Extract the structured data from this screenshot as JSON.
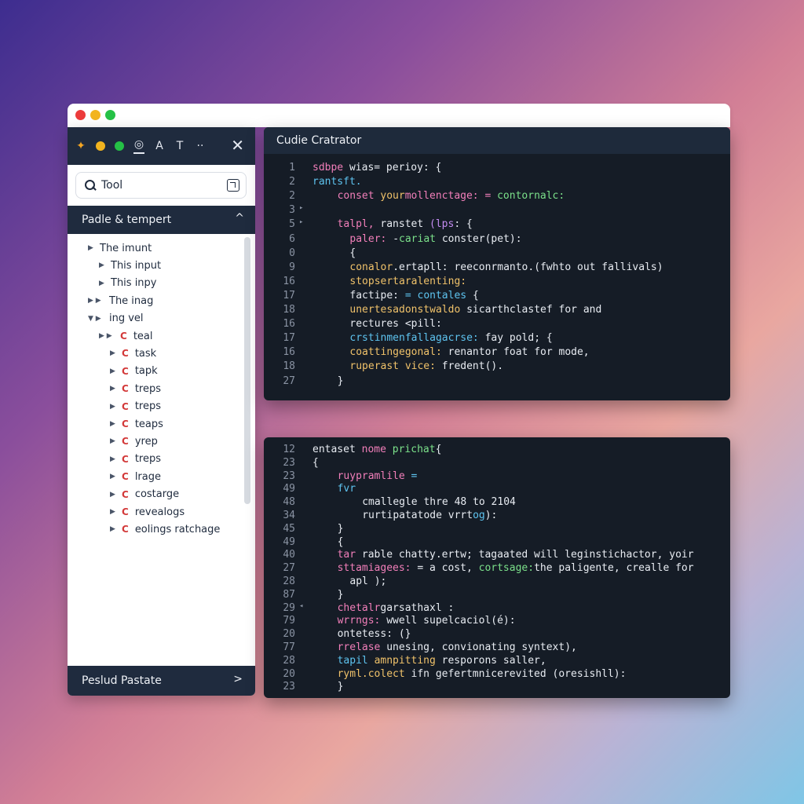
{
  "toolbar": {
    "tools": [
      "spark-tool",
      "yellow-tool",
      "green-tool",
      "globe-tool",
      "lock-tool",
      "text-tool",
      "more-tool"
    ],
    "tool_glyphs": [
      "✦",
      "",
      "",
      "◎",
      "A",
      "T",
      "··"
    ],
    "close_glyph": "✕"
  },
  "search": {
    "value": "Tool"
  },
  "section": {
    "title": "Padle & tempert",
    "chevron": "^"
  },
  "tree": [
    {
      "label": "The imunt",
      "level": 0,
      "arrow": "▶",
      "icon": ""
    },
    {
      "label": "This input",
      "level": 1,
      "arrow": "▶",
      "icon": ""
    },
    {
      "label": "This inpy",
      "level": 1,
      "arrow": "▶",
      "icon": ""
    },
    {
      "label": "The inag",
      "level": 0,
      "arrow": "▶ ▶",
      "icon": ""
    },
    {
      "label": "ing vel",
      "level": 0,
      "arrow": "▼ ▶",
      "icon": ""
    },
    {
      "label": "teal",
      "level": 1,
      "arrow": "▶ ▶",
      "icon": "C"
    },
    {
      "label": "task",
      "level": 2,
      "arrow": "▶",
      "icon": "C"
    },
    {
      "label": "tapk",
      "level": 2,
      "arrow": "▶",
      "icon": "C"
    },
    {
      "label": "treps",
      "level": 2,
      "arrow": "▶",
      "icon": "C"
    },
    {
      "label": "treps",
      "level": 2,
      "arrow": "▶",
      "icon": "C"
    },
    {
      "label": "teaps",
      "level": 2,
      "arrow": "▶",
      "icon": "C"
    },
    {
      "label": "yrep",
      "level": 2,
      "arrow": "▶",
      "icon": "C"
    },
    {
      "label": "treps",
      "level": 2,
      "arrow": "▶",
      "icon": "C"
    },
    {
      "label": "lrage",
      "level": 2,
      "arrow": "▶",
      "icon": "C"
    },
    {
      "label": "costarge",
      "level": 2,
      "arrow": "▶",
      "icon": "C"
    },
    {
      "label": "revealogs",
      "level": 2,
      "arrow": "▶",
      "icon": "C"
    },
    {
      "label": "eolings ratchage",
      "level": 2,
      "arrow": "▶",
      "icon": "C"
    }
  ],
  "footer": {
    "label": "Peslud Pastate",
    "chevron": ">"
  },
  "editor_top": {
    "title": "Cudie Cratrator",
    "lines": [
      {
        "n": "1",
        "indent": 0,
        "parts": [
          [
            "pink",
            "sdbpe "
          ],
          [
            "white",
            "wias= perioy: {"
          ]
        ]
      },
      {
        "n": "2",
        "indent": 0,
        "parts": [
          [
            "blue",
            "rantsft."
          ]
        ]
      },
      {
        "n": "2",
        "indent": 2,
        "parts": [
          [
            "pink",
            "conset "
          ],
          [
            "yellow",
            "your"
          ],
          [
            "pink",
            "mollenctage: = "
          ],
          [
            "green",
            "contornalc:"
          ]
        ]
      },
      {
        "n": "3",
        "indent": 0,
        "fold": "▸",
        "parts": []
      },
      {
        "n": "5",
        "indent": 2,
        "fold": "▸",
        "parts": [
          [
            "pink",
            "talpl, "
          ],
          [
            "white",
            "ranstet "
          ],
          [
            "purple",
            "(lps"
          ],
          [
            "white",
            ": {"
          ]
        ]
      },
      {
        "n": "6",
        "indent": 3,
        "parts": [
          [
            "pink",
            "paler: "
          ],
          [
            "white",
            "-"
          ],
          [
            "green",
            "cariat "
          ],
          [
            "white",
            "conster(pet):"
          ]
        ]
      },
      {
        "n": "0",
        "indent": 3,
        "parts": [
          [
            "white",
            "{"
          ]
        ]
      },
      {
        "n": "9",
        "indent": 3,
        "parts": [
          [
            "yellow",
            "conalor"
          ],
          [
            "white",
            ".ertapll: reeconrmanto.(fwhto out fallivals)"
          ]
        ]
      },
      {
        "n": "16",
        "indent": 3,
        "parts": [
          [
            "yellow",
            "stopsertaralenting:"
          ]
        ]
      },
      {
        "n": "17",
        "indent": 3,
        "parts": [
          [
            "white",
            "factipe: "
          ],
          [
            "blue",
            "= contales "
          ],
          [
            "white",
            "{"
          ]
        ]
      },
      {
        "n": "18",
        "indent": 3,
        "parts": [
          [
            "yellow",
            "unertesadonstwaldo "
          ],
          [
            "white",
            "sicarthclastef for and"
          ]
        ]
      },
      {
        "n": "16",
        "indent": 3,
        "parts": [
          [
            "white",
            " rectures <pill:"
          ]
        ]
      },
      {
        "n": "17",
        "indent": 3,
        "parts": [
          [
            "blue",
            " crstinmenfallagacrse: "
          ],
          [
            "white",
            "fay pold; {"
          ]
        ]
      },
      {
        "n": "16",
        "indent": 3,
        "parts": [
          [
            "yellow",
            " coattingegonal: "
          ],
          [
            "white",
            "renantor foat for mode,"
          ]
        ]
      },
      {
        "n": "18",
        "indent": 3,
        "parts": [
          [
            "yellow",
            "ruperast vice: "
          ],
          [
            "white",
            "fredent()."
          ]
        ]
      },
      {
        "n": "27",
        "indent": 2,
        "parts": [
          [
            "white",
            "}"
          ]
        ]
      }
    ]
  },
  "editor_bottom": {
    "lines": [
      {
        "n": "12",
        "indent": 0,
        "parts": [
          [
            "white",
            "entaset "
          ],
          [
            "pink",
            "nome "
          ],
          [
            "green",
            "prichat"
          ],
          [
            "white",
            "{"
          ]
        ]
      },
      {
        "n": "23",
        "indent": 0,
        "parts": [
          [
            "white",
            "{"
          ]
        ]
      },
      {
        "n": "23",
        "indent": 2,
        "parts": [
          [
            "pink",
            "ruypramlile "
          ],
          [
            "blue",
            "="
          ]
        ]
      },
      {
        "n": "49",
        "indent": 2,
        "parts": [
          [
            "blue",
            "fvr"
          ]
        ]
      },
      {
        "n": "48",
        "indent": 4,
        "parts": [
          [
            "white",
            "cmallegle thre 48 to 2104"
          ]
        ]
      },
      {
        "n": "34",
        "indent": 4,
        "parts": [
          [
            "white",
            "rurtipatatode "
          ],
          [
            "white",
            "vrrt"
          ],
          [
            "blue",
            "og"
          ],
          [
            "white",
            "):"
          ]
        ]
      },
      {
        "n": "45",
        "indent": 2,
        "parts": [
          [
            "white",
            "}"
          ]
        ]
      },
      {
        "n": "49",
        "indent": 2,
        "parts": [
          [
            "white",
            "{"
          ]
        ]
      },
      {
        "n": "40",
        "indent": 2,
        "parts": [
          [
            "pink",
            " tar "
          ],
          [
            "white",
            "rable chatty.ertw; tagaated will leginstichactor, yoir"
          ]
        ]
      },
      {
        "n": "27",
        "indent": 2,
        "parts": [
          [
            "pink",
            " sttamiagees: "
          ],
          [
            "white",
            "= a cost, "
          ],
          [
            "green",
            "cortsage:"
          ],
          [
            "white",
            "the paligente, crealle for"
          ]
        ]
      },
      {
        "n": "28",
        "indent": 3,
        "parts": [
          [
            "white",
            "apl );"
          ]
        ]
      },
      {
        "n": "87",
        "indent": 2,
        "parts": [
          [
            "white",
            "}"
          ]
        ]
      },
      {
        "n": "29",
        "indent": 2,
        "fold": "◂",
        "parts": [
          [
            "pink",
            "chetalr"
          ],
          [
            "white",
            "garsathaxl :"
          ]
        ]
      },
      {
        "n": "79",
        "indent": 2,
        "parts": [
          [
            "pink",
            "wrrngs: "
          ],
          [
            "white",
            "wwell supelcaciol(é):"
          ]
        ]
      },
      {
        "n": "20",
        "indent": 2,
        "parts": [
          [
            "white",
            " ontetess: (}"
          ]
        ]
      },
      {
        "n": "77",
        "indent": 2,
        "parts": [
          [
            "pink",
            " rrelase "
          ],
          [
            "white",
            "unesing, convionating syntext),"
          ]
        ]
      },
      {
        "n": "28",
        "indent": 2,
        "parts": [
          [
            "blue",
            " tapil "
          ],
          [
            "yellow",
            "amnpitting "
          ],
          [
            "white",
            "resporons saller,"
          ]
        ]
      },
      {
        "n": "20",
        "indent": 2,
        "parts": [
          [
            "yellow",
            " ryml.colect "
          ],
          [
            "white",
            "ifn gefertmnicerevited (oresishll):"
          ]
        ]
      },
      {
        "n": "23",
        "indent": 2,
        "parts": [
          [
            "white",
            " }"
          ]
        ]
      }
    ]
  }
}
